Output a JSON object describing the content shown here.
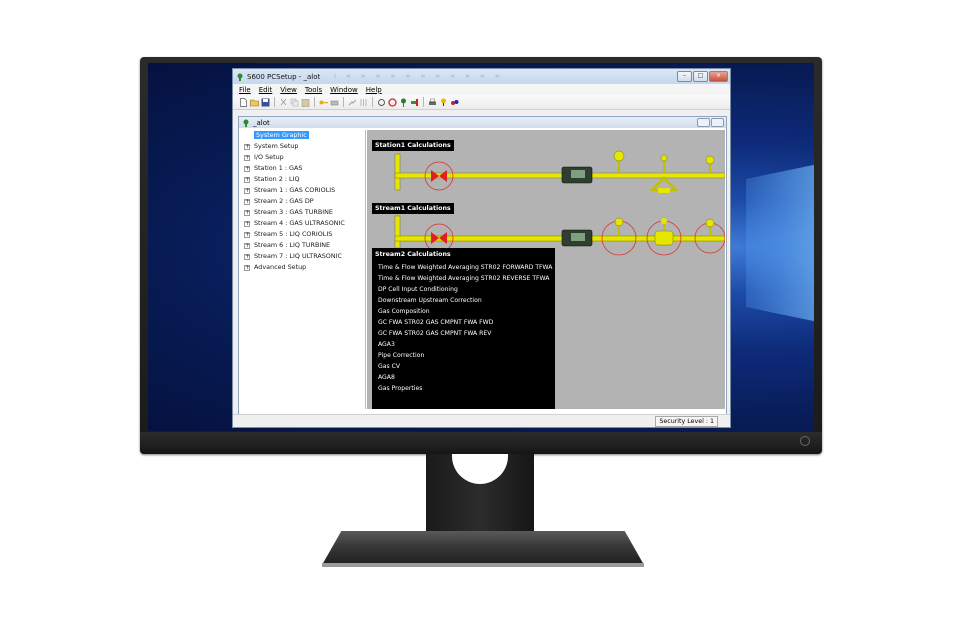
{
  "window": {
    "title": "S600 PCSetup - _alot",
    "title_ghost": "i    ∞    ∞    ∞    ∞    ∞    ∞    ∞    ∞    ∞    ∞    ∞"
  },
  "menu": [
    "File",
    "Edit",
    "View",
    "Tools",
    "Window",
    "Help"
  ],
  "child_window": {
    "title": "_alot"
  },
  "tree": {
    "items": [
      {
        "label": "System Graphic",
        "selected": true
      },
      {
        "label": "System Setup"
      },
      {
        "label": "I/O Setup"
      },
      {
        "label": "Station 1 : GAS"
      },
      {
        "label": "Station 2 : LIQ"
      },
      {
        "label": "Stream 1 : GAS CORIOLIS"
      },
      {
        "label": "Stream 2 : GAS DP"
      },
      {
        "label": "Stream 3 : GAS TURBINE"
      },
      {
        "label": "Stream 4 : GAS ULTRASONIC"
      },
      {
        "label": "Stream 5 : LIQ CORIOLIS"
      },
      {
        "label": "Stream 6 : LIQ TURBINE"
      },
      {
        "label": "Stream 7 : LIQ ULTRASONIC"
      },
      {
        "label": "Advanced Setup"
      }
    ]
  },
  "graphic": {
    "station1_label": "Station1 Calculations",
    "stream1_label": "Stream1 Calculations",
    "stream2_label": "Stream2 Calculations",
    "stream2_items": [
      "Time & Flow Weighted Averaging STR02 FORWARD TFWA",
      "Time & Flow Weighted Averaging STR02 REVERSE TFWA",
      "DP Cell Input Conditioning",
      "Downstream Upstream Correction",
      "Gas Composition",
      "GC FWA STR02 GAS CMPNT FWA FWD",
      "GC FWA STR02 GAS CMPNT FWA REV",
      "AGA3",
      "Pipe Correction",
      "Gas CV",
      "AGA8",
      "Gas Properties"
    ]
  },
  "status": {
    "security": "Security Level : 1"
  },
  "colors": {
    "pipe": "#e6e600",
    "valve": "#ff2a2a",
    "selection": "#3399ff"
  }
}
